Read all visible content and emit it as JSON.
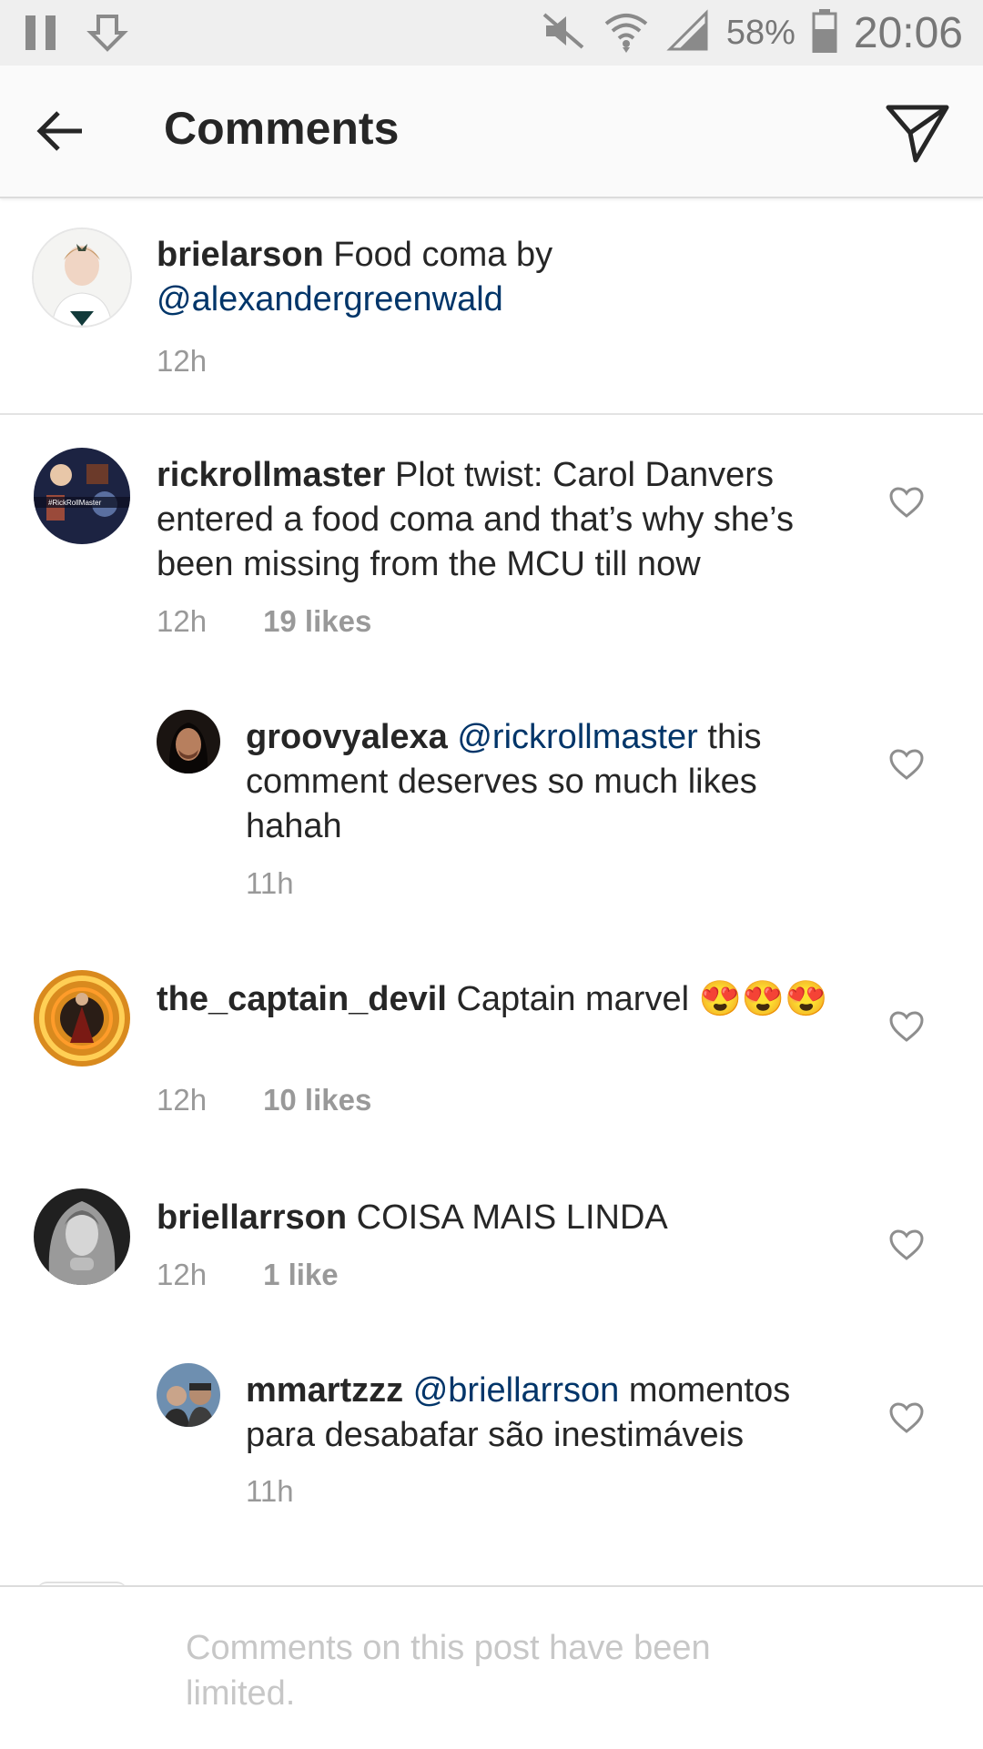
{
  "status_bar": {
    "battery_percent": "58%",
    "time": "20:06",
    "icons": [
      "pause-icon",
      "download-icon",
      "mute-icon",
      "wifi-icon",
      "signal-icon",
      "battery-icon"
    ]
  },
  "header": {
    "title": "Comments",
    "icons": [
      "back-arrow-icon",
      "direct-send-icon"
    ]
  },
  "caption": {
    "username": "brielarson",
    "text": "Food coma by",
    "mention": "@alexandergreenwald",
    "time": "12h"
  },
  "comments": [
    {
      "username": "rickrollmaster",
      "text": "Plot twist: Carol Danvers entered a food coma and that’s why she’s been missing from the MCU till now",
      "time": "12h",
      "likes": "19 likes",
      "avatar_text": "#RickRollMaster"
    },
    {
      "username": "groovyalexa",
      "mention": "@rickrollmaster",
      "text": "this comment deserves so much likes hahah",
      "time": "11h",
      "reply": true
    },
    {
      "username": "the_captain_devil",
      "text": "Captain marvel 😍😍😍",
      "time": "12h",
      "likes": "10 likes"
    },
    {
      "username": "briellarrson",
      "text": "COISA MAIS LINDA",
      "time": "12h",
      "likes": "1 like"
    },
    {
      "username": "mmartzzz",
      "mention": "@briellarrson",
      "text": "momentos para desabafar são inestimáveis",
      "time": "11h",
      "reply": true
    }
  ],
  "footer": {
    "limited_text": "Comments on this post have been limited."
  },
  "colors": {
    "mention": "#003569",
    "meta": "#999999",
    "text": "#262626"
  }
}
